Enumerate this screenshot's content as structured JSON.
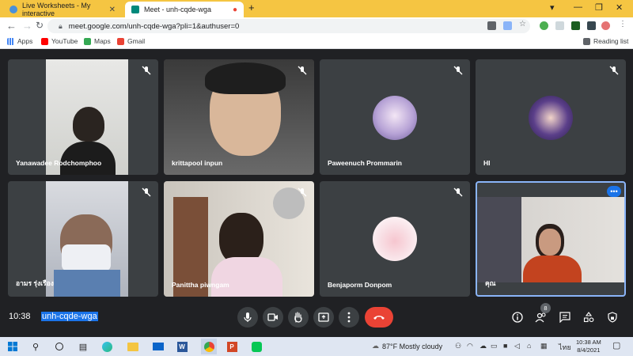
{
  "browser": {
    "tabs": [
      {
        "title": "Live Worksheets - My interactive",
        "close": "✕"
      },
      {
        "title": "Meet - unh-cqde-wga",
        "close": "●"
      }
    ],
    "new_tab": "+",
    "url": "meet.google.com/unh-cqde-wga?pli=1&authuser=0",
    "bookmarks": [
      {
        "label": "Apps"
      },
      {
        "label": "YouTube"
      },
      {
        "label": "Maps"
      },
      {
        "label": "Gmail"
      }
    ],
    "reading_list": "Reading list"
  },
  "participants": [
    {
      "name": "Yanawadee Rodchomphoo",
      "kind": "video"
    },
    {
      "name": "krittapool inpun",
      "kind": "video"
    },
    {
      "name": "Paweenuch Prommarin",
      "kind": "avatar"
    },
    {
      "name": "HI",
      "kind": "avatar"
    },
    {
      "name": "อามร รุ่งเรือง",
      "kind": "video"
    },
    {
      "name": "Panittha piwngam",
      "kind": "video"
    },
    {
      "name": "Benjaporm Donpom",
      "kind": "avatar"
    },
    {
      "name": "คุณ",
      "kind": "video",
      "self": true
    }
  ],
  "meeting": {
    "time": "10:38",
    "code": "unh-cqde-wga",
    "participant_count": "8",
    "more_label": "•••"
  },
  "taskbar": {
    "weather": "87°F  Mostly cloudy",
    "language": "ไทย",
    "time": "10:38 AM",
    "date": "8/4/2021"
  },
  "colors": {
    "accent": "#1a73e8",
    "end_call": "#ea4335",
    "tab_strip": "#f5c542",
    "tile_bg": "#3c4043",
    "page_bg": "#202124"
  }
}
